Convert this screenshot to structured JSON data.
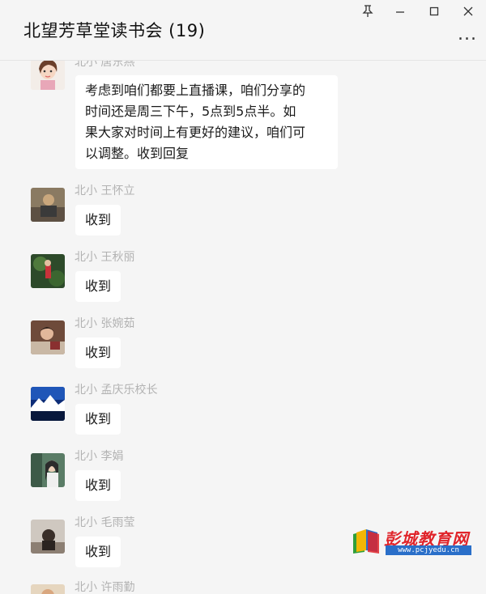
{
  "window": {
    "title": "北望芳草堂读书会 (19)",
    "controls": [
      "pin-icon",
      "minimize-icon",
      "maximize-icon",
      "close-icon"
    ],
    "more_label": "..."
  },
  "messages": [
    {
      "sender": "北小 唐东燕",
      "text": "考虑到咱们都要上直播课，咱们分享的时间还是周三下午，5点到5点半。如果大家对时间上有更好的建议，咱们可以调整。收到回复",
      "lines": [
        "考虑到咱们都要上直播课，咱们分享的",
        "时间还是周三下午，5点到5点半。如",
        "果大家对时间上有更好的建议，咱们可",
        "以调整。收到回复"
      ]
    },
    {
      "sender": "北小 王怀立",
      "text": "收到"
    },
    {
      "sender": "北小 王秋丽",
      "text": "收到"
    },
    {
      "sender": "北小 张婉茹",
      "text": "收到"
    },
    {
      "sender": "北小 孟庆乐校长",
      "text": "收到"
    },
    {
      "sender": "北小 李娟",
      "text": "收到"
    },
    {
      "sender": "北小 毛雨莹",
      "text": "收到"
    },
    {
      "sender": "北小 许雨勤",
      "text": ""
    }
  ],
  "watermark": {
    "brand": "彭城教育网",
    "url": "www.pcjyedu.cn"
  },
  "colors": {
    "background": "#f5f5f5",
    "bubble": "#ffffff",
    "sender_name": "#b2b2b2",
    "watermark_red": "#e0242a",
    "watermark_blue": "#2a6fc9"
  }
}
